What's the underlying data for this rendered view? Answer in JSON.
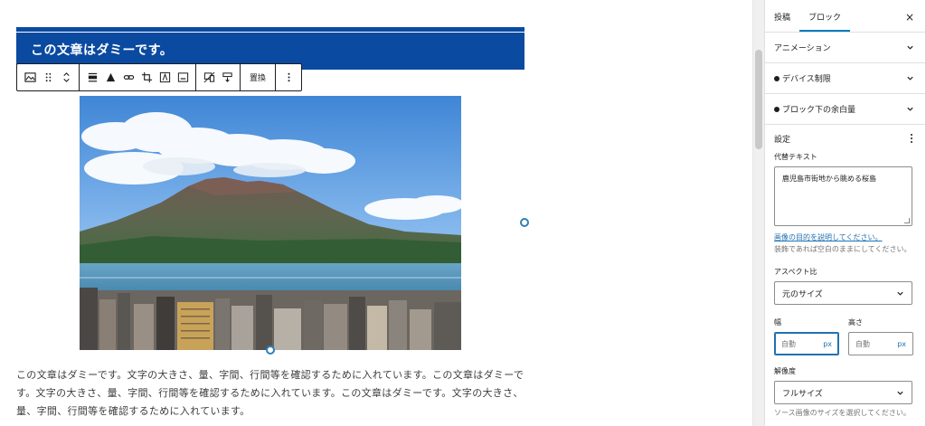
{
  "heading": {
    "text": "この文章はダミーです。"
  },
  "toolbar": {
    "replace_label": "置換"
  },
  "paragraph": {
    "text": "この文章はダミーです。文字の大きさ、量、字間、行間等を確認するために入れています。この文章はダミーです。文字の大きさ、量、字間、行間等を確認するために入れています。この文章はダミーです。文字の大きさ、量、字間、行間等を確認するために入れています。"
  },
  "sidebar": {
    "tabs": [
      {
        "label": "投稿"
      },
      {
        "label": "ブロック"
      }
    ],
    "close_label": "×",
    "panels": [
      {
        "label": "アニメーション"
      },
      {
        "label": "デバイス制限"
      },
      {
        "label": "ブロック下の余白量"
      }
    ],
    "settings": {
      "title": "設定",
      "alt_label": "代替テキスト",
      "alt_value": "鹿児島市街地から眺める桜島",
      "alt_help_link": "画像の目的を説明してください。",
      "alt_help_text": "装飾であれば空白のままにしてください。",
      "aspect_label": "アスペクト比",
      "aspect_value": "元のサイズ",
      "width_label": "幅",
      "height_label": "高さ",
      "width_value": "自動",
      "height_value": "自動",
      "unit": "px",
      "resolution_label": "解像度",
      "resolution_value": "フルサイズ",
      "resolution_help": "ソース画像のサイズを選択してください。"
    }
  },
  "colors": {
    "heading_bg": "#0a4aa0",
    "accent": "#2271b1"
  }
}
